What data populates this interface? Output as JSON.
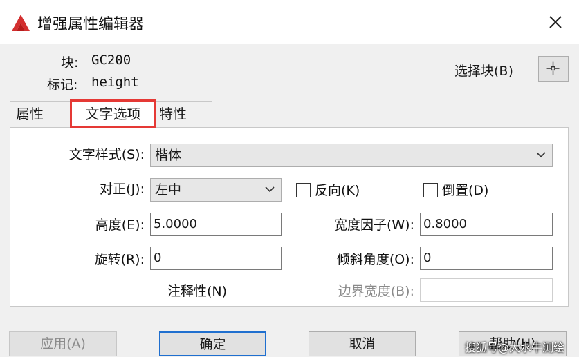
{
  "window": {
    "title": "增强属性编辑器"
  },
  "info": {
    "block_label": "块:",
    "block_value": "GC200",
    "tag_label": "标记:",
    "tag_value": "height",
    "select_block_label": "选择块(B)"
  },
  "tabs": [
    {
      "label": "属性",
      "active": false
    },
    {
      "label": "文字选项",
      "active": true
    },
    {
      "label": "特性",
      "active": false
    }
  ],
  "form": {
    "text_style_label": "文字样式(S):",
    "text_style_value": "楷体",
    "justify_label": "对正(J):",
    "justify_value": "左中",
    "backwards_label": "反向(K)",
    "backwards_checked": false,
    "upside_down_label": "倒置(D)",
    "upside_down_checked": false,
    "height_label": "高度(E):",
    "height_value": "5.0000",
    "width_factor_label": "宽度因子(W):",
    "width_factor_value": "0.8000",
    "rotation_label": "旋转(R):",
    "rotation_value": "0",
    "oblique_label": "倾斜角度(O):",
    "oblique_value": "0",
    "annotative_label": "注释性(N)",
    "annotative_checked": false,
    "boundary_width_label": "边界宽度(B):",
    "boundary_width_value": ""
  },
  "buttons": {
    "apply": "应用(A)",
    "ok": "确定",
    "cancel": "取消",
    "help": "帮助(H)"
  },
  "watermark": "搜狐号@大水牛测绘",
  "colors": {
    "highlight_border": "#e53935",
    "default_button_border": "#1f6fcf",
    "app_icon": "#d32f2f"
  }
}
